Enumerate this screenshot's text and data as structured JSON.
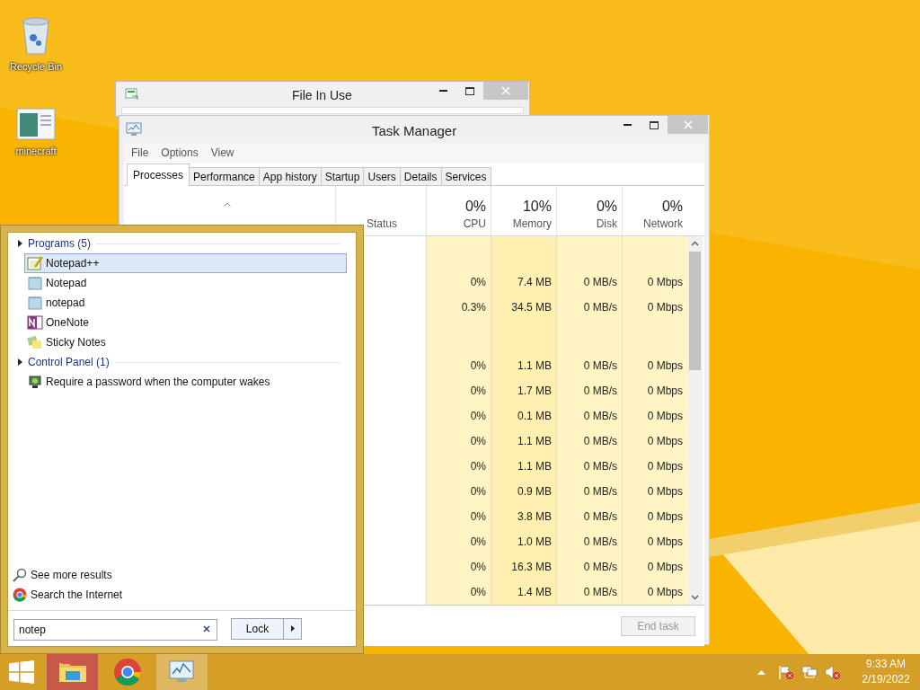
{
  "desktop_icons": [
    {
      "kind": "recycle",
      "label": "Recycle Bin"
    },
    {
      "kind": "window",
      "label": "minecraft"
    }
  ],
  "file_in_use": {
    "title": "File In Use"
  },
  "task_manager": {
    "title": "Task Manager",
    "menu": [
      "File",
      "Options",
      "View"
    ],
    "tabs": [
      {
        "label": "Processes",
        "selected": true
      },
      {
        "label": "Performance",
        "selected": false
      },
      {
        "label": "App history",
        "selected": false
      },
      {
        "label": "Startup",
        "selected": false
      },
      {
        "label": "Users",
        "selected": false
      },
      {
        "label": "Details",
        "selected": false
      },
      {
        "label": "Services",
        "selected": false
      }
    ],
    "status_header": "Status",
    "columns": [
      {
        "percent": "0%",
        "label": "CPU"
      },
      {
        "percent": "10%",
        "label": "Memory"
      },
      {
        "percent": "0%",
        "label": "Disk"
      },
      {
        "percent": "0%",
        "label": "Network"
      }
    ],
    "rows": [
      {
        "kind": "group"
      },
      {
        "kind": "process",
        "cells": [
          "0%",
          "7.4 MB",
          "0 MB/s",
          "0 Mbps"
        ]
      },
      {
        "kind": "process",
        "cells": [
          "0.3%",
          "34.5 MB",
          "0 MB/s",
          "0 Mbps"
        ]
      },
      {
        "kind": "group"
      },
      {
        "kind": "process",
        "cells": [
          "0%",
          "1.1 MB",
          "0 MB/s",
          "0 Mbps"
        ]
      },
      {
        "kind": "process",
        "cells": [
          "0%",
          "1.7 MB",
          "0 MB/s",
          "0 Mbps"
        ]
      },
      {
        "kind": "process",
        "cells": [
          "0%",
          "0.1 MB",
          "0 MB/s",
          "0 Mbps"
        ]
      },
      {
        "kind": "process",
        "cells": [
          "0%",
          "1.1 MB",
          "0 MB/s",
          "0 Mbps"
        ]
      },
      {
        "kind": "process",
        "cells": [
          "0%",
          "1.1 MB",
          "0 MB/s",
          "0 Mbps"
        ]
      },
      {
        "kind": "process",
        "cells": [
          "0%",
          "0.9 MB",
          "0 MB/s",
          "0 Mbps"
        ]
      },
      {
        "kind": "process",
        "cells": [
          "0%",
          "3.8 MB",
          "0 MB/s",
          "0 Mbps"
        ]
      },
      {
        "kind": "process",
        "cells": [
          "0%",
          "1.0 MB",
          "0 MB/s",
          "0 Mbps"
        ]
      },
      {
        "kind": "process",
        "cells": [
          "0%",
          "16.3 MB",
          "0 MB/s",
          "0 Mbps"
        ]
      },
      {
        "kind": "process",
        "cells": [
          "0%",
          "1.4 MB",
          "0 MB/s",
          "0 Mbps"
        ]
      }
    ],
    "end_task": {
      "label": "End task",
      "disabled": true
    }
  },
  "start_menu": {
    "sections": [
      {
        "label": "Programs (5)",
        "items": [
          {
            "kind": "notepadpp",
            "label": "Notepad++",
            "selected": true
          },
          {
            "kind": "notepad",
            "label": "Notepad",
            "selected": false
          },
          {
            "kind": "notepad",
            "label": "notepad",
            "selected": false
          },
          {
            "kind": "onenote",
            "label": "OneNote",
            "selected": false
          },
          {
            "kind": "sticky",
            "label": "Sticky Notes",
            "selected": false
          }
        ]
      },
      {
        "label": "Control Panel (1)",
        "items": [
          {
            "kind": "power",
            "label": "Require a password when the computer wakes",
            "selected": false
          }
        ]
      }
    ],
    "links": [
      {
        "kind": "search",
        "label": "See more results"
      },
      {
        "kind": "chrome",
        "label": "Search the Internet"
      }
    ],
    "search": {
      "value": "notep"
    },
    "power_button": "Lock"
  },
  "taskbar": {
    "apps": [
      {
        "kind": "explorer",
        "color": "#c8594a"
      },
      {
        "kind": "chrome"
      },
      {
        "kind": "taskmgr",
        "color": "#e1b862"
      }
    ],
    "time": "9:33 AM",
    "date": "2/19/2022"
  }
}
